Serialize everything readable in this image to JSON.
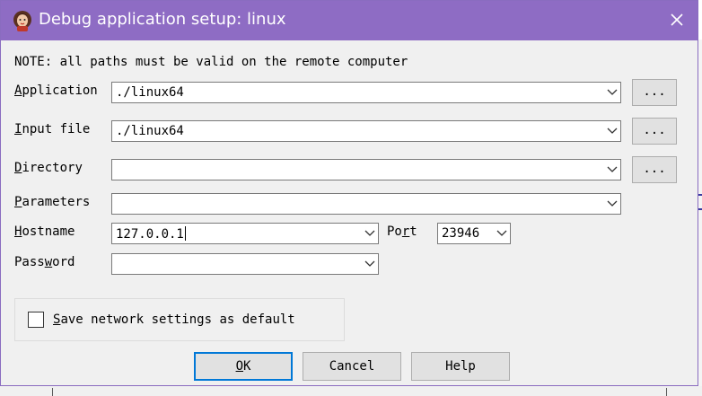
{
  "window": {
    "title": "Debug application setup: linux",
    "title_bar_color": "#8e6cc4",
    "close_icon": "close-icon"
  },
  "note": "NOTE: all paths must be valid on the remote computer",
  "fields": {
    "application": {
      "label_mnemonic": "A",
      "label_rest": "pplication",
      "value": "./linux64",
      "browse_label": "..."
    },
    "input_file": {
      "label_mnemonic": "I",
      "label_rest": "nput file",
      "value": "./linux64",
      "browse_label": "..."
    },
    "directory": {
      "label_mnemonic": "D",
      "label_rest": "irectory",
      "value": "",
      "browse_label": "..."
    },
    "parameters": {
      "label_mnemonic": "P",
      "label_rest": "arameters",
      "value": ""
    },
    "hostname": {
      "label_mnemonic": "H",
      "label_rest": "ostname",
      "value": "127.0.0.1"
    },
    "port": {
      "label_pre": "Po",
      "label_mnemonic": "r",
      "label_rest": "t",
      "value": "23946"
    },
    "password": {
      "label_pre": "Pass",
      "label_mnemonic": "w",
      "label_rest": "ord",
      "value": ""
    }
  },
  "save_settings": {
    "label_mnemonic": "S",
    "label_rest": "ave network settings as default",
    "checked": false
  },
  "buttons": {
    "ok": {
      "mnemonic": "O",
      "rest": "K"
    },
    "cancel": "Cancel",
    "help": "Help"
  }
}
